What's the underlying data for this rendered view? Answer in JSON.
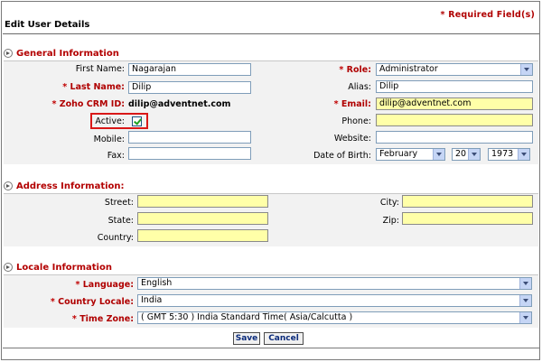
{
  "header": {
    "title": "Edit User Details",
    "required_note": "* Required Field(s)"
  },
  "general": {
    "heading": "General Information",
    "first_name_label": "First Name:",
    "first_name_value": "Nagarajan",
    "last_name_label": "Last Name:",
    "last_name_value": "Dilip",
    "crm_id_label": "Zoho CRM ID:",
    "crm_id_value": "dilip@adventnet.com",
    "active_label": "Active:",
    "active_checked": true,
    "mobile_label": "Mobile:",
    "mobile_value": "",
    "fax_label": "Fax:",
    "fax_value": "",
    "role_label": "Role:",
    "role_value": "Administrator",
    "alias_label": "Alias:",
    "alias_value": "Dilip",
    "email_label": "Email:",
    "email_value": "dilip@adventnet.com",
    "phone_label": "Phone:",
    "phone_value": "",
    "website_label": "Website:",
    "website_value": "",
    "dob_label": "Date of Birth:",
    "dob_month": "February",
    "dob_day": "20",
    "dob_year": "1973"
  },
  "address": {
    "heading": "Address Information:",
    "street_label": "Street:",
    "state_label": "State:",
    "country_label": "Country:",
    "city_label": "City:",
    "zip_label": "Zip:"
  },
  "locale": {
    "heading": "Locale Information",
    "language_label": "Language:",
    "language_value": "English",
    "country_locale_label": "Country Locale:",
    "country_locale_value": "India",
    "time_zone_label": "Time Zone:",
    "time_zone_value": "( GMT 5:30 ) India Standard Time( Asia/Calcutta )"
  },
  "actions": {
    "save_label": "Save",
    "cancel_label": "Cancel"
  },
  "colors": {
    "required": "#b00000",
    "highlight_box": "#d91818",
    "required_field_bg": "#ffffa8",
    "panel_bg": "#f2f2f2"
  }
}
